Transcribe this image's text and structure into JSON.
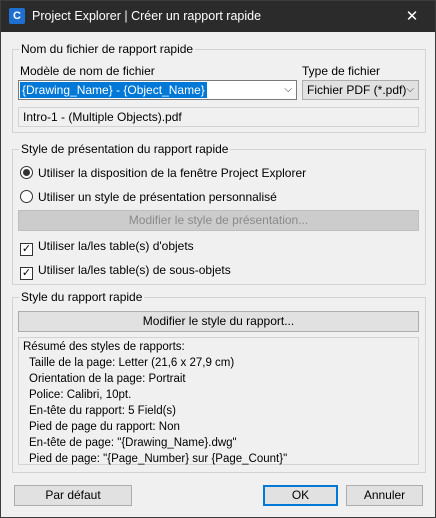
{
  "window": {
    "title": "Project Explorer | Créer un rapport rapide",
    "app_icon_letter": "C",
    "close_glyph": "✕"
  },
  "file_name_group": {
    "legend": "Nom du fichier de rapport rapide",
    "template_label": "Modèle de nom de fichier",
    "template_value": "{Drawing_Name} - {Object_Name}",
    "file_type_label": "Type de fichier",
    "file_type_value": "Fichier PDF (*.pdf)",
    "preview": "Intro-1 - (Multiple Objects).pdf"
  },
  "presentation_group": {
    "legend": "Style de présentation du rapport rapide",
    "radio_explorer_label": "Utiliser la disposition de la fenêtre Project Explorer",
    "radio_custom_label": "Utiliser un style de présentation personnalisé",
    "modify_presentation_label": "Modifier le style de présentation...",
    "check_objects_label": "Utiliser la/les table(s) d'objets",
    "check_subobjects_label": "Utiliser la/les table(s) de sous-objets",
    "radio_explorer_selected": true,
    "check_objects_checked": true,
    "check_subobjects_checked": true
  },
  "report_style_group": {
    "legend": "Style du rapport rapide",
    "modify_report_label": "Modifier le style du rapport...",
    "summary_title": "Résumé des styles de rapports:",
    "summary_lines": [
      "Taille de la page: Letter (21,6 x 27,9 cm)",
      "Orientation de la page: Portrait",
      "Police: Calibri, 10pt.",
      "En-tête du rapport: 5 Field(s)",
      "Pied de page du rapport: Non",
      "En-tête de page: \"{Drawing_Name}.dwg\"",
      "Pied de page: \"{Page_Number} sur {Page_Count}\""
    ]
  },
  "footer": {
    "default_label": "Par défaut",
    "ok_label": "OK",
    "cancel_label": "Annuler"
  }
}
